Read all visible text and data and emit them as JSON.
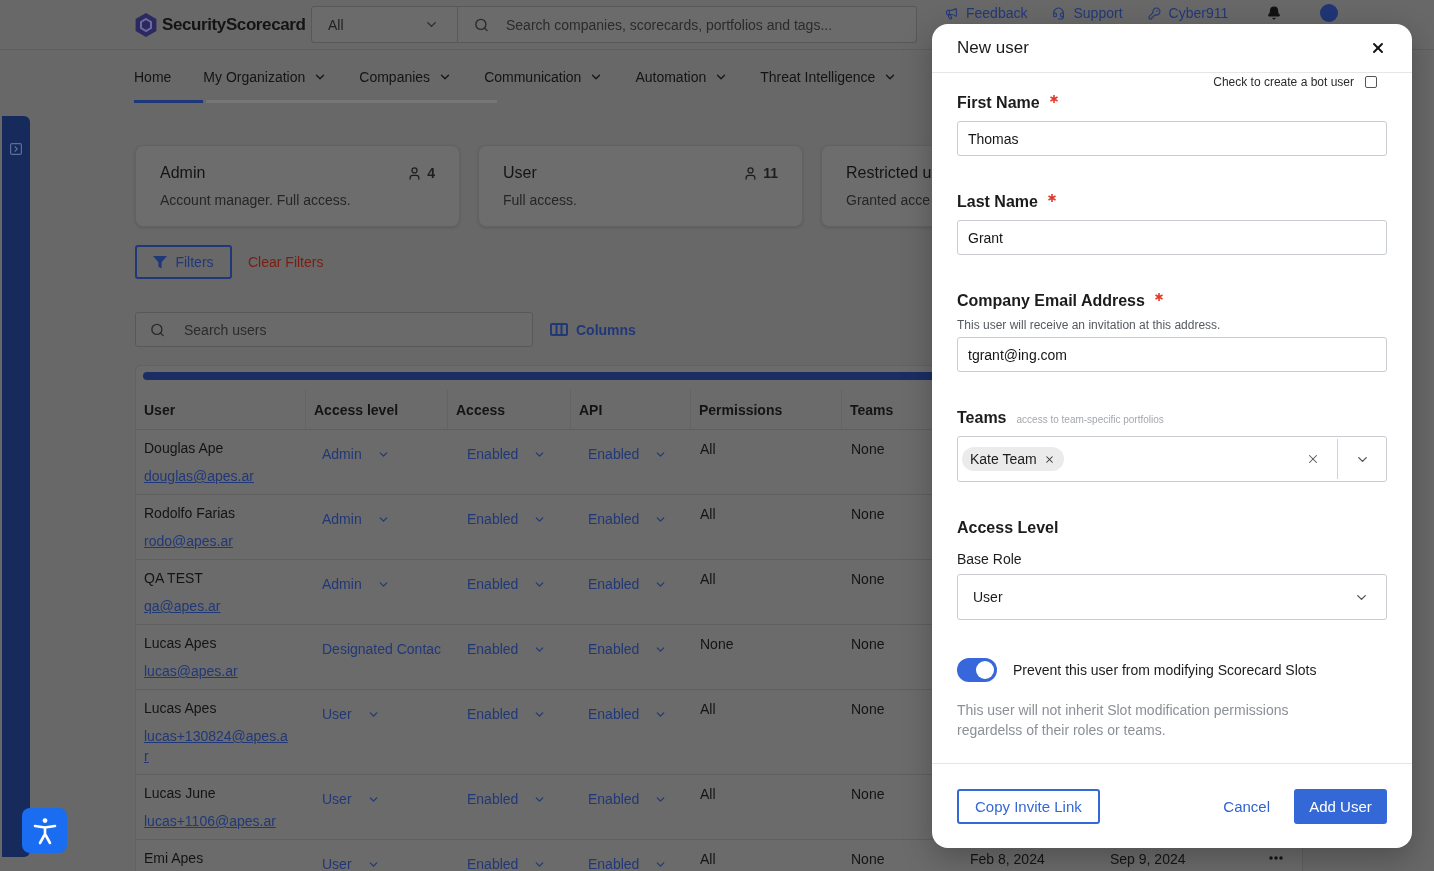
{
  "header": {
    "brand": "SecurityScorecard",
    "scope_select": {
      "value": "All"
    },
    "search": {
      "placeholder": "Search companies, scorecards, portfolios and tags..."
    },
    "links": [
      {
        "label": "Feedback"
      },
      {
        "label": "Support"
      },
      {
        "label": "Cyber911"
      }
    ]
  },
  "nav": [
    {
      "label": "Home",
      "kind": "link",
      "selected": true
    },
    {
      "label": "My Organization",
      "kind": "menu",
      "selected": false
    },
    {
      "label": "Companies",
      "kind": "menu",
      "selected": false
    },
    {
      "label": "Communication",
      "kind": "menu",
      "selected": false
    },
    {
      "label": "Automation",
      "kind": "menu",
      "selected": false
    },
    {
      "label": "Threat Intelligence",
      "kind": "menu",
      "selected": false
    }
  ],
  "role_cards": [
    {
      "title": "Admin",
      "description": "Account manager. Full access.",
      "count": "4"
    },
    {
      "title": "User",
      "description": "Full access.",
      "count": "11"
    },
    {
      "title": "Restricted u",
      "description": "Granted acce"
    }
  ],
  "filters": {
    "button": "Filters",
    "clear": "Clear Filters"
  },
  "toolbar": {
    "search": {
      "placeholder": "Search users"
    },
    "columns_button": "Columns"
  },
  "table": {
    "columns": [
      "User",
      "Access level",
      "Access",
      "API",
      "Permissions",
      "Teams"
    ],
    "rows": [
      {
        "name": "Douglas Ape",
        "email": "douglas@apes.ar",
        "access_level": {
          "value": "Admin",
          "kind": "dropdown"
        },
        "access": "Enabled",
        "api": "Enabled",
        "permissions": "All",
        "teams": "None"
      },
      {
        "name": "Rodolfo Farias",
        "email": "rodo@apes.ar",
        "access_level": {
          "value": "Admin",
          "kind": "dropdown"
        },
        "access": "Enabled",
        "api": "Enabled",
        "permissions": "All",
        "teams": "None"
      },
      {
        "name": "QA TEST",
        "email": "qa@apes.ar",
        "access_level": {
          "value": "Admin",
          "kind": "dropdown"
        },
        "access": "Enabled",
        "api": "Enabled",
        "permissions": "All",
        "teams": "None"
      },
      {
        "name": "Lucas Apes",
        "email": "lucas@apes.ar",
        "access_level": {
          "value": "Designated Contac",
          "kind": "overflowing"
        },
        "access": "Enabled",
        "api": "Enabled",
        "permissions": "None",
        "teams": "None"
      },
      {
        "name": "Lucas Apes",
        "email": "lucas+130824@apes.ar",
        "access_level": {
          "value": "User",
          "kind": "dropdown"
        },
        "access": "Enabled",
        "api": "Enabled",
        "permissions": "All",
        "teams": "None"
      },
      {
        "name": "Lucas June",
        "email": "lucas+1106@apes.ar",
        "access_level": {
          "value": "User",
          "kind": "dropdown"
        },
        "access": "Enabled",
        "api": "Enabled",
        "permissions": "All",
        "teams": "None"
      },
      {
        "name": "Emi Apes",
        "access_level": {
          "value": "User",
          "kind": "dropdown"
        },
        "access": "Enabled",
        "api": "Enabled",
        "permissions": "All",
        "teams": "None",
        "column_7": "Feb 8, 2024",
        "column_8": "Sep 9, 2024",
        "more_menu": true
      }
    ]
  },
  "modal": {
    "title": "New user",
    "bot_user": {
      "label": "Check to create a bot user",
      "checked": false
    },
    "fields": [
      {
        "kind": "text",
        "label": "First Name",
        "required": true,
        "value": "Thomas"
      },
      {
        "kind": "text",
        "label": "Last Name",
        "required": true,
        "value": "Grant"
      },
      {
        "kind": "text",
        "label": "Company Email Address",
        "required": true,
        "help": "This user will receive an invitation at this address.",
        "value": "tgrant@ing.com"
      },
      {
        "kind": "multiselect",
        "label": "Teams",
        "hint": "access to team-specific portfolios",
        "chips": [
          "Kate Team"
        ]
      }
    ],
    "access": {
      "heading": "Access Level",
      "base_role_label": "Base Role",
      "base_role": "User"
    },
    "slot_toggle": {
      "label": "Prevent this user from modifying Scorecard Slots",
      "on": true,
      "description": "This user will not inherit Slot modification permissions regardelss of their roles or teams."
    },
    "buttons": {
      "copy_link": "Copy Invite Link",
      "cancel": "Cancel",
      "submit": "Add User"
    }
  }
}
